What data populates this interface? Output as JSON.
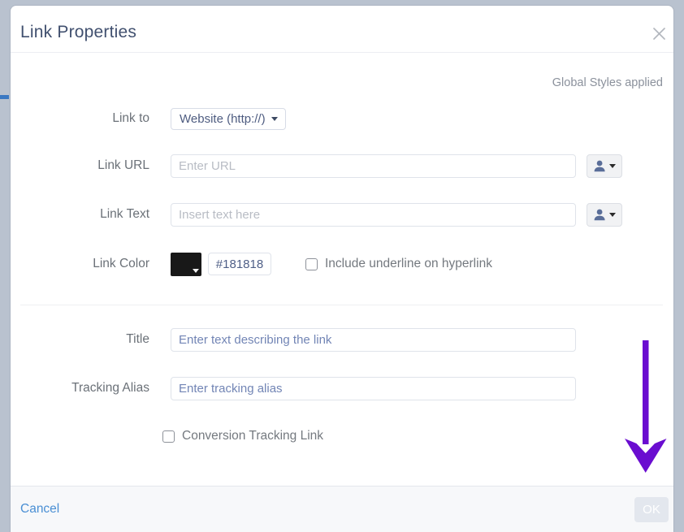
{
  "background_color": "#b9c2cf",
  "dialog": {
    "title": "Link Properties",
    "close_icon": "close-icon",
    "note": "Global Styles applied",
    "rows": {
      "link_to": {
        "label": "Link to",
        "selected_option": "Website (http://)",
        "caret_icon": "chevron-down-icon"
      },
      "link_url": {
        "label": "Link URL",
        "value": "",
        "placeholder": "Enter URL",
        "picker_icon": "person-icon",
        "picker_caret_icon": "chevron-down-icon"
      },
      "link_text": {
        "label": "Link Text",
        "value": "",
        "placeholder": "Insert text here",
        "picker_icon": "person-icon",
        "picker_caret_icon": "chevron-down-icon"
      },
      "link_color": {
        "label": "Link Color",
        "swatch_color": "#181818",
        "swatch_caret_icon": "chevron-down-icon",
        "hex_value": "#181818",
        "underline_checkbox": {
          "label": "Include underline on hyperlink",
          "checked": false
        }
      },
      "title": {
        "label": "Title",
        "value": "",
        "placeholder": "Enter text describing the link"
      },
      "tracking_alias": {
        "label": "Tracking Alias",
        "value": "",
        "placeholder": "Enter tracking alias"
      },
      "conversion_tracking": {
        "label": "Conversion Tracking Link",
        "checked": false
      }
    },
    "footer": {
      "cancel_label": "Cancel",
      "cancel_color": "#4a8fd4",
      "ok_label": "OK",
      "ok_enabled": false,
      "ok_background": "#e3e7ee"
    }
  },
  "annotation": {
    "type": "arrow",
    "direction": "down",
    "color": "#6A0DD0",
    "points_at": "ok-button"
  }
}
